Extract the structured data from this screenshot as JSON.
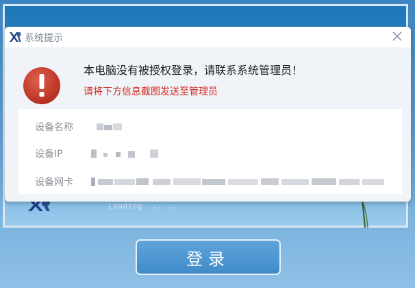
{
  "dialog": {
    "title": "系统提示",
    "message": "本电脑没有被授权登录，请联系系统管理员！",
    "sub_message": "请将下方信息截图发送至管理员",
    "fields": [
      {
        "label": "设备名称"
      },
      {
        "label": "设备IP"
      },
      {
        "label": "设备网卡"
      }
    ]
  },
  "background": {
    "loading_text": "Loading ......",
    "login_label": "登录"
  },
  "icons": {
    "title_logo": "xr-logo-icon",
    "close": "close-icon",
    "alert": "error-exclamation-icon"
  },
  "colors": {
    "alert_red": "#c93a2c",
    "sub_message_red": "#d0281f",
    "login_button": "#4f98d4"
  }
}
